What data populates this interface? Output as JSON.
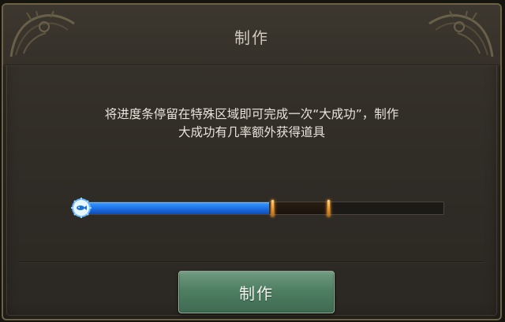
{
  "dialog": {
    "title": "制作",
    "description_line1": "将进度条停留在特殊区域即可完成一次“大成功”，制作",
    "description_line2": "大成功有几率额外获得道具"
  },
  "progress": {
    "fill_fraction": 0.52,
    "special_zone_start_fraction": 0.53,
    "special_zone_end_fraction": 0.685,
    "handle_icon": "fish-gear-icon"
  },
  "actions": {
    "craft_label": "制作"
  },
  "colors": {
    "progress_fill": "#1b6ee4",
    "zone_marker": "#f09a2a",
    "button": "#4f7f63"
  }
}
